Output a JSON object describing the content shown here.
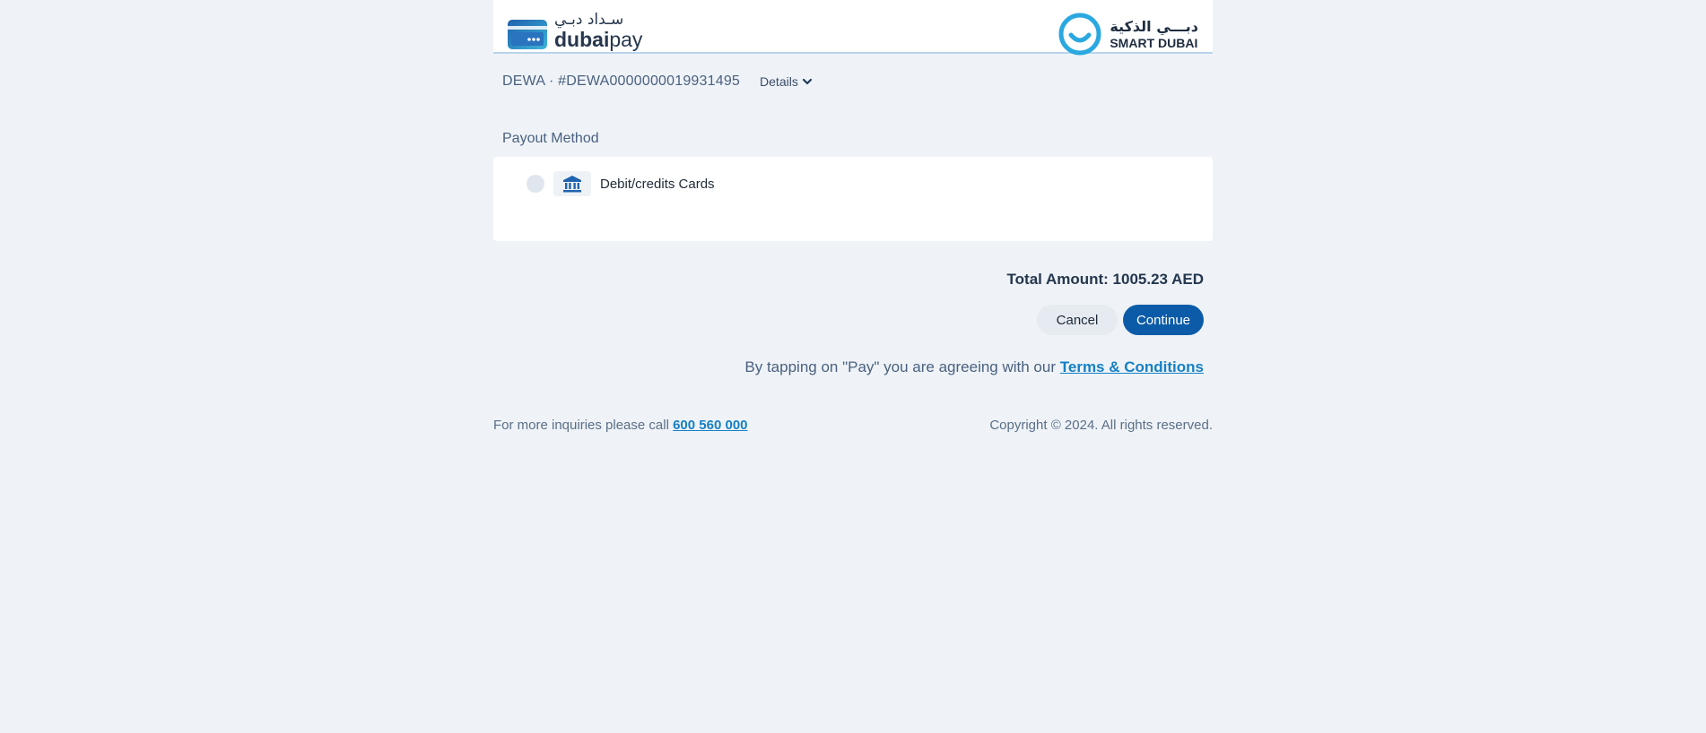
{
  "header": {
    "dubaipay_logo_arabic": "سـداد دبـي",
    "dubaipay_logo_bold": "dubai",
    "dubaipay_logo_light": "pay",
    "smartdubai_logo_arabic": "دبـــي الذكية",
    "smartdubai_logo_latin": "SMART DUBAI"
  },
  "reference": {
    "text": "DEWA · #DEWA0000000019931495",
    "details_label": "Details"
  },
  "payout": {
    "title": "Payout Method",
    "methods": [
      {
        "label": "Debit/credits Cards",
        "icon": "bank-icon",
        "selected": false
      }
    ]
  },
  "summary": {
    "total_label": "Total Amount: 1005.23 AED"
  },
  "actions": {
    "cancel_label": "Cancel",
    "continue_label": "Continue"
  },
  "terms": {
    "prefix": "By tapping on \"Pay\" you are agreeing with our",
    "link_label": "Terms & Conditions"
  },
  "footer": {
    "inquiry_prefix": "For more inquiries please call",
    "phone": "600 560 000",
    "copyright": "Copyright © 2024. All rights reserved."
  },
  "colors": {
    "background": "#eff3f7",
    "primary": "#0c5ba8",
    "link": "#1680c4",
    "smart_dubai_blue": "#2aa8e0"
  }
}
